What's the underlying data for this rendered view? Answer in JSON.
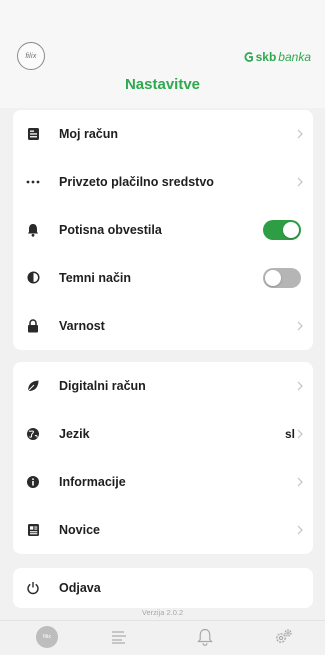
{
  "header": {
    "logo_text": "ﬁlix",
    "brand_main": "skb",
    "brand_sub": "banka",
    "title": "Nastavitve"
  },
  "section1": {
    "items": [
      {
        "label": "Moj račun",
        "icon": "account-document-icon"
      },
      {
        "label": "Privzeto plačilno sredstvo",
        "icon": "more-dots-icon"
      },
      {
        "label": "Potisna obvestila",
        "icon": "bell-icon",
        "toggle": true
      },
      {
        "label": "Temni način",
        "icon": "contrast-icon",
        "toggle": false
      },
      {
        "label": "Varnost",
        "icon": "lock-icon"
      }
    ]
  },
  "section2": {
    "items": [
      {
        "label": "Digitalni račun",
        "icon": "leaf-icon"
      },
      {
        "label": "Jezik",
        "icon": "globe-icon",
        "value": "sl"
      },
      {
        "label": "Informacije",
        "icon": "info-icon"
      },
      {
        "label": "Novice",
        "icon": "news-icon"
      }
    ]
  },
  "section3": {
    "items": [
      {
        "label": "Odjava",
        "icon": "power-icon"
      }
    ]
  },
  "version": "Verzija 2.0.2",
  "tabbar": {
    "home_text": "ﬁlix"
  },
  "colors": {
    "accent": "#2fa84f",
    "toggle_on": "#2e9e44",
    "toggle_off": "#b5b5b5"
  }
}
